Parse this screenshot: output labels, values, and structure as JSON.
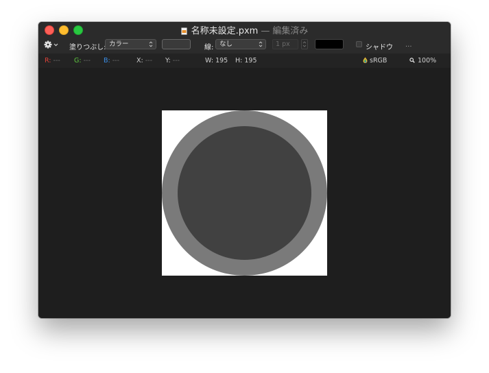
{
  "window": {
    "title": "名称未設定.pxm",
    "separator": "—",
    "edited": "編集済み"
  },
  "toolbar": {
    "fill_label": "塗りつぶし:",
    "fill_select": "カラー",
    "stroke_label": "線:",
    "stroke_select": "なし",
    "stroke_width_placeholder": "1 px",
    "stroke_color": "#000000",
    "shadow_label": "シャドウ",
    "more": "..."
  },
  "infobar": {
    "r_label": "R:",
    "r_value": "---",
    "g_label": "G:",
    "g_value": "---",
    "b_label": "B:",
    "b_value": "---",
    "x_label": "X:",
    "x_value": "---",
    "y_label": "Y:",
    "y_value": "---",
    "w_label": "W:",
    "w_value": "195",
    "h_label": "H:",
    "h_value": "195",
    "colorspace": "sRGB",
    "zoom": "100%"
  },
  "colors": {
    "r": "#e0433a",
    "g": "#5fc540",
    "b": "#3b8fe8",
    "ring": "#7a7a7a",
    "inner": "#414141",
    "canvas": "#ffffff"
  },
  "icons": {
    "document": "document-icon",
    "gear": "gear-icon",
    "colorspace": "color-drop-icon",
    "zoom": "magnifier-icon"
  }
}
